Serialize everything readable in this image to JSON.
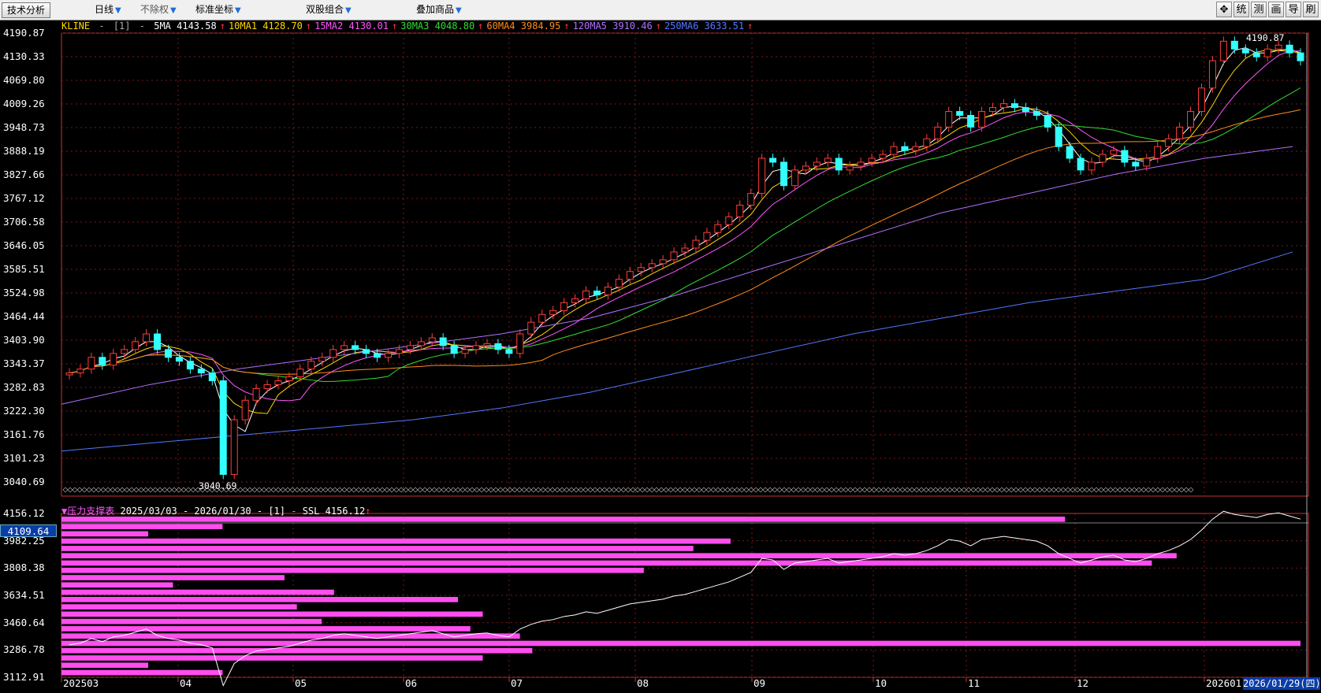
{
  "toolbar": {
    "title": "技术分析",
    "items": [
      {
        "label": "日线"
      },
      {
        "label": "不除权"
      },
      {
        "label": "标准坐标"
      },
      {
        "label": "双股组合"
      },
      {
        "label": "叠加商品"
      }
    ],
    "buttons": [
      "✥",
      "统",
      "测",
      "画",
      "导",
      "刷"
    ]
  },
  "legend": {
    "kline": "KLINE",
    "param": "[1]",
    "ma": [
      {
        "label": "5MA 4143.58",
        "color": "#ffffff"
      },
      {
        "label": "10MA1 4128.70",
        "color": "#ffd700"
      },
      {
        "label": "15MA2 4130.01",
        "color": "#ff55ff"
      },
      {
        "label": "30MA3 4048.80",
        "color": "#33dd33"
      },
      {
        "label": "60MA4 3984.95",
        "color": "#ff8c1a"
      },
      {
        "label": "120MA5 3910.46",
        "color": "#b070ff"
      },
      {
        "label": "250MA6 3633.51",
        "color": "#5577ff"
      }
    ]
  },
  "price_axis": [
    "4190.87",
    "4130.33",
    "4069.80",
    "4009.26",
    "3948.73",
    "3888.19",
    "3827.66",
    "3767.12",
    "3706.58",
    "3646.05",
    "3585.51",
    "3524.98",
    "3464.44",
    "3403.90",
    "3343.37",
    "3282.83",
    "3222.30",
    "3161.76",
    "3101.23",
    "3040.69"
  ],
  "annotations": {
    "high": "4190.87",
    "low": "3040.69"
  },
  "panel": {
    "title": "压力支撑表",
    "range": "2025/03/03 - 2026/01/30 - [1]",
    "ssl": "SSL 4156.12",
    "axis": [
      "4156.12",
      "3982.25",
      "3808.38",
      "3634.51",
      "3460.64",
      "3286.78",
      "3112.91"
    ],
    "current_price": "4109.64",
    "volume_profile": [
      0.81,
      0.13,
      0.07,
      0.54,
      0.51,
      0.9,
      0.88,
      0.47,
      0.18,
      0.09,
      0.22,
      0.32,
      0.19,
      0.34,
      0.21,
      0.33,
      0.37,
      1.0,
      0.38,
      0.34,
      0.07,
      0.13
    ]
  },
  "date_axis": [
    "202503",
    "04",
    "05",
    "06",
    "07",
    "08",
    "09",
    "10",
    "11",
    "12",
    "202601"
  ],
  "selected_date": "2026/01/29(四)",
  "chart_data": {
    "type": "line",
    "title": "",
    "y_range": [
      3040.69,
      4190.87
    ],
    "series_close_approx": [
      3320,
      3330,
      3360,
      3340,
      3370,
      3380,
      3400,
      3420,
      3380,
      3360,
      3350,
      3330,
      3320,
      3300,
      3060,
      3200,
      3250,
      3280,
      3290,
      3300,
      3310,
      3330,
      3350,
      3360,
      3380,
      3390,
      3380,
      3370,
      3360,
      3370,
      3380,
      3390,
      3400,
      3410,
      3390,
      3370,
      3380,
      3390,
      3395,
      3380,
      3370,
      3420,
      3450,
      3470,
      3480,
      3500,
      3510,
      3530,
      3520,
      3540,
      3560,
      3580,
      3590,
      3600,
      3610,
      3630,
      3640,
      3660,
      3680,
      3700,
      3720,
      3750,
      3780,
      3870,
      3860,
      3800,
      3840,
      3850,
      3860,
      3870,
      3840,
      3850,
      3860,
      3870,
      3880,
      3900,
      3890,
      3900,
      3920,
      3950,
      3990,
      3980,
      3950,
      3990,
      4000,
      4010,
      4000,
      3990,
      3980,
      3950,
      3900,
      3870,
      3840,
      3860,
      3880,
      3890,
      3860,
      3850,
      3870,
      3900,
      3920,
      3950,
      3990,
      4050,
      4120,
      4170,
      4150,
      4140,
      4130,
      4150,
      4160,
      4140,
      4120
    ]
  }
}
